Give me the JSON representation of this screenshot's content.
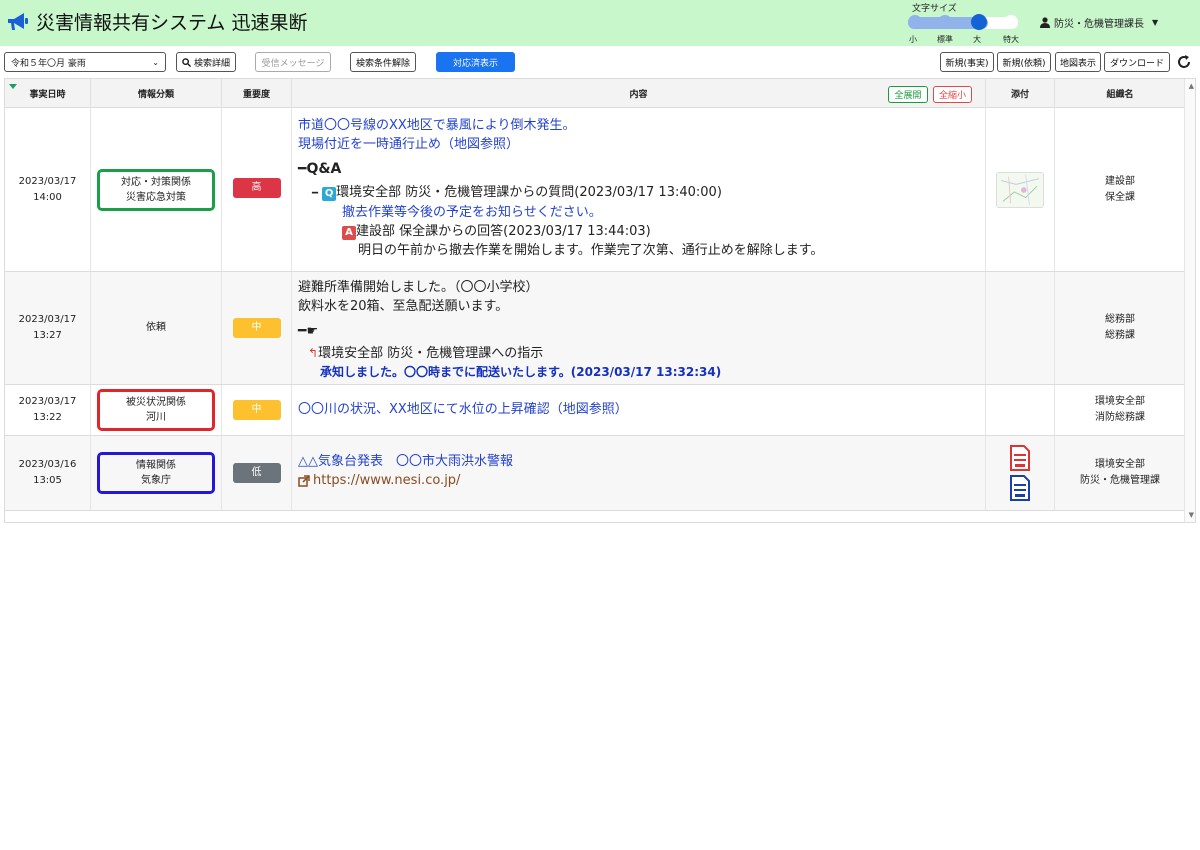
{
  "header": {
    "title": "災害情報共有システム 迅速果断",
    "font_size": {
      "label": "文字サイズ",
      "options": [
        "小",
        "標準",
        "大",
        "特大"
      ],
      "selected": "大"
    },
    "user": "防災・危機管理課長",
    "bg_color": "#c9f7cc"
  },
  "toolbar": {
    "event_select": "令和５年〇月 豪雨",
    "search_detail": "検索詳細",
    "received_messages": "受信メッセージ",
    "clear_conditions": "検索条件解除",
    "show_handled": "対応済表示",
    "new_fact": "新規(事実)",
    "new_request": "新規(依頼)",
    "map_view": "地図表示",
    "download": "ダウンロード"
  },
  "table": {
    "headers": {
      "datetime": "事実日時",
      "category": "情報分類",
      "priority": "重要度",
      "content": "内容",
      "expand_all": "全展開",
      "collapse_all": "全縮小",
      "attachments": "添付",
      "organization": "組織名"
    },
    "rows": [
      {
        "date": "2023/03/17",
        "time": "14:00",
        "category_line1": "対応・対策関係",
        "category_line2": "災害応急対策",
        "category_color": "#1a9e46",
        "priority": "高",
        "content_line1": "市道〇〇号線のXX地区で暴風により倒木発生。",
        "content_line2": "現場付近を一時通行止め（地図参照）",
        "qa_label": "Q&A",
        "question_tag": "Q",
        "question_title": "環境安全部 防災・危機管理課からの質問(2023/03/17 13:40:00)",
        "question_body": "撤去作業等今後の予定をお知らせください。",
        "answer_tag": "A",
        "answer_title": "建設部 保全課からの回答(2023/03/17 13:44:03)",
        "answer_body": "明日の午前から撤去作業を開始します。作業完了次第、通行止めを解除します。",
        "org_line1": "建設部",
        "org_line2": "保全課"
      },
      {
        "date": "2023/03/17",
        "time": "13:27",
        "category": "依頼",
        "priority": "中",
        "content_line1": "避難所準備開始しました。（〇〇小学校）",
        "content_line2": "飲料水を20箱、至急配送願います。",
        "instruction_title": "環境安全部 防災・危機管理課への指示",
        "instruction_reply": "承知しました。〇〇時までに配送いたします。(2023/03/17 13:32:34)",
        "org_line1": "総務部",
        "org_line2": "総務課"
      },
      {
        "date": "2023/03/17",
        "time": "13:22",
        "category_line1": "被災状況関係",
        "category_line2": "河川",
        "category_color": "#e0262c",
        "priority": "中",
        "content_line1": "〇〇川の状況、XX地区にて水位の上昇確認（地図参照）",
        "org_line1": "環境安全部",
        "org_line2": "消防総務課"
      },
      {
        "date": "2023/03/16",
        "time": "13:05",
        "category_line1": "情報関係",
        "category_line2": "気象庁",
        "category_color": "#2417d6",
        "priority": "低",
        "content_line1": "△△気象台発表　〇〇市大雨洪水警報",
        "link": "https://www.nesi.co.jp/",
        "org_line1": "環境安全部",
        "org_line2": "防災・危機管理課"
      }
    ]
  }
}
